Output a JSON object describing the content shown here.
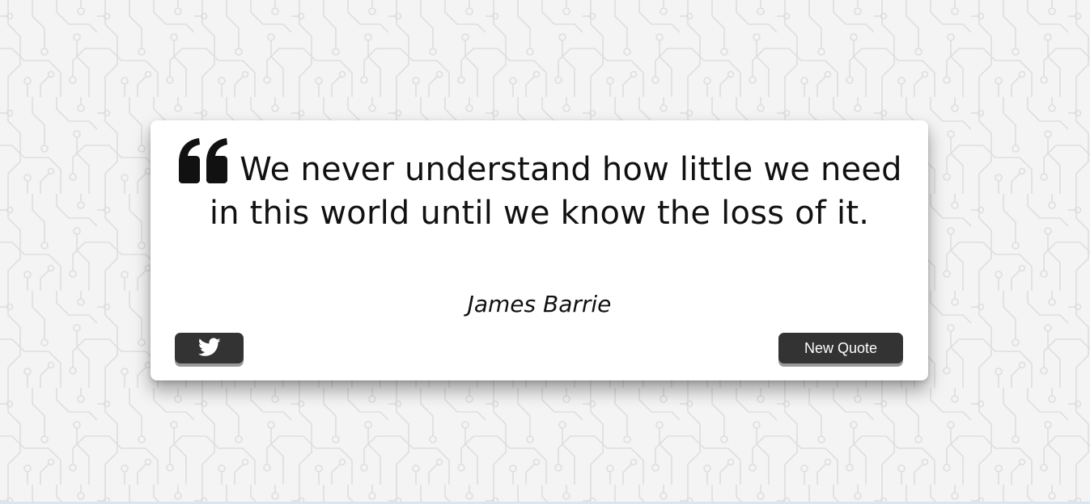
{
  "quote": {
    "text": "We never understand how little we need in this world until we know the loss of it.",
    "author": "James Barrie",
    "icon": "quote-left-icon"
  },
  "actions": {
    "tweet_icon": "twitter-icon",
    "new_quote_label": "New Quote"
  },
  "colors": {
    "background": "#f4f4f4",
    "pattern": "#e2e2e2",
    "card": "#ffffff",
    "text": "#111111",
    "button": "#333333",
    "button_text": "#ffffff"
  }
}
